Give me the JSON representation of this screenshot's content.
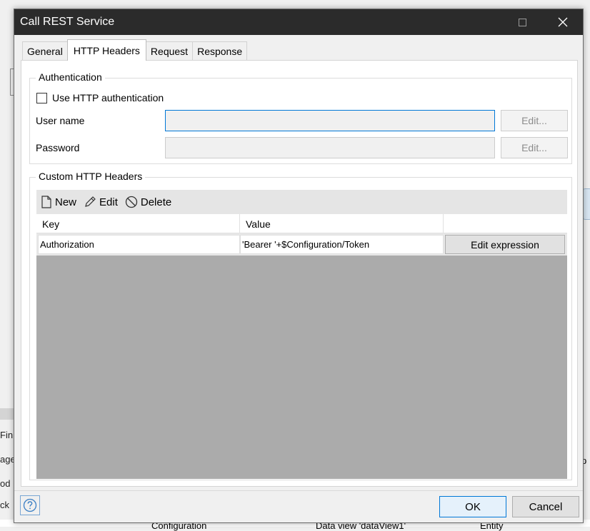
{
  "background": {
    "left_texts": [
      "Fin",
      "age",
      "od",
      "ck"
    ],
    "right_text": "p",
    "bottom_texts": [
      "Configuration",
      "Data view 'dataView1'",
      "Entity"
    ]
  },
  "dialog": {
    "title": "Call REST Service",
    "tabs": [
      {
        "label": "General",
        "active": false
      },
      {
        "label": "HTTP Headers",
        "active": true
      },
      {
        "label": "Request",
        "active": false
      },
      {
        "label": "Response",
        "active": false
      }
    ]
  },
  "authentication": {
    "legend": "Authentication",
    "use_http_auth_label": "Use HTTP authentication",
    "use_http_auth_checked": false,
    "username_label": "User name",
    "username_value": "",
    "password_label": "Password",
    "password_value": "",
    "edit_label": "Edit..."
  },
  "custom_headers": {
    "legend": "Custom HTTP Headers",
    "toolbar": {
      "new_label": "New",
      "edit_label": "Edit",
      "delete_label": "Delete"
    },
    "columns": [
      "Key",
      "Value",
      ""
    ],
    "rows": [
      {
        "key": "Authorization",
        "value": "'Bearer '+$Configuration/Token",
        "action": "Edit expression"
      }
    ]
  },
  "footer": {
    "help_icon": "question-mark",
    "ok_label": "OK",
    "cancel_label": "Cancel"
  },
  "colors": {
    "titlebar": "#2b2b2b",
    "accent": "#0078d7",
    "grid_background": "#ababab"
  }
}
